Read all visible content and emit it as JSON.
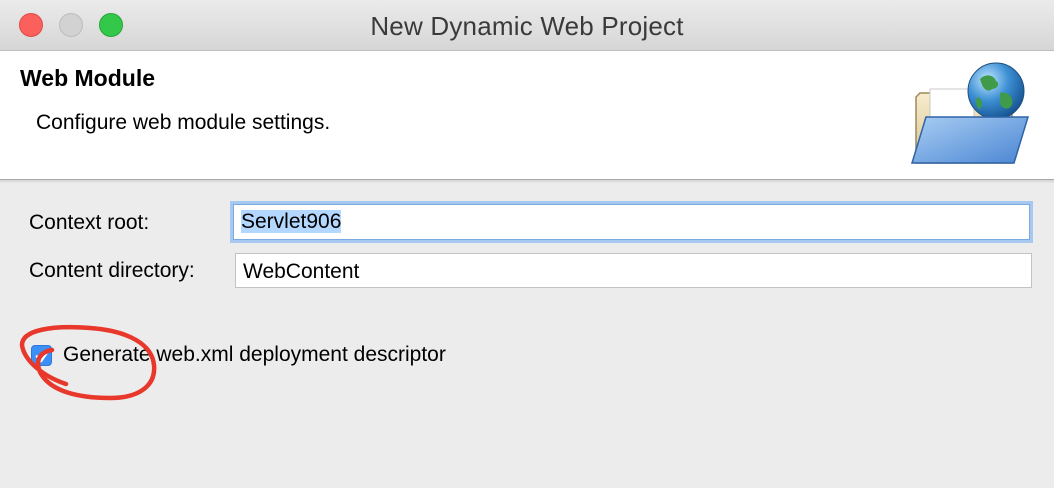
{
  "window": {
    "title": "New Dynamic Web Project"
  },
  "banner": {
    "title": "Web Module",
    "description": "Configure web module settings.",
    "icon": "folder-globe-icon"
  },
  "form": {
    "context_root": {
      "label": "Context root:",
      "value": "Servlet906"
    },
    "content_directory": {
      "label": "Content directory:",
      "value": "WebContent"
    },
    "generate_descriptor": {
      "label": "Generate web.xml deployment descriptor",
      "checked": true
    }
  },
  "colors": {
    "accent": "#3c8ff7",
    "annotation": "#e8382b",
    "close": "#fc605c",
    "zoom": "#34c84a"
  }
}
